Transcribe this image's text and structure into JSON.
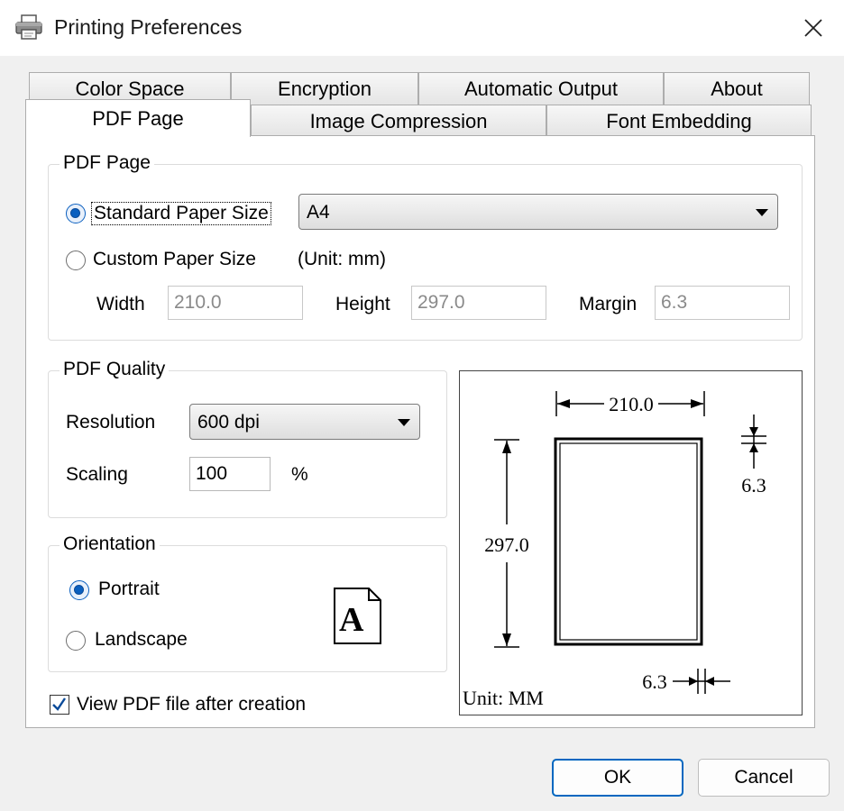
{
  "window": {
    "title": "Printing Preferences",
    "close_icon": "close-icon",
    "app_icon": "printer-icon"
  },
  "tabs": {
    "row1": [
      "Color Space",
      "Encryption",
      "Automatic Output",
      "About"
    ],
    "row2": [
      "PDF Page",
      "Image Compression",
      "Font Embedding"
    ],
    "active": "PDF Page"
  },
  "pdf_page": {
    "group_label": "PDF Page",
    "standard_label": "Standard Paper Size",
    "standard_selected": true,
    "paper_size_value": "A4",
    "custom_label": "Custom Paper Size",
    "unit_note": "(Unit: mm)",
    "width_label": "Width",
    "width_value": "210.0",
    "height_label": "Height",
    "height_value": "297.0",
    "margin_label": "Margin",
    "margin_value": "6.3"
  },
  "quality": {
    "group_label": "PDF Quality",
    "resolution_label": "Resolution",
    "resolution_value": "600 dpi",
    "scaling_label": "Scaling",
    "scaling_value": "100",
    "percent": "%"
  },
  "orientation": {
    "group_label": "Orientation",
    "portrait_label": "Portrait",
    "landscape_label": "Landscape",
    "selected": "Portrait",
    "icon_letter": "A"
  },
  "preview": {
    "width": "210.0",
    "height": "297.0",
    "margin_top": "6.3",
    "margin_bottom": "6.3",
    "unit": "Unit: MM"
  },
  "view_after": {
    "label": "View PDF file after creation",
    "checked": true
  },
  "buttons": {
    "ok": "OK",
    "cancel": "Cancel"
  },
  "colors": {
    "accent": "#0067c0",
    "radio_fill": "#0a5fbf"
  }
}
